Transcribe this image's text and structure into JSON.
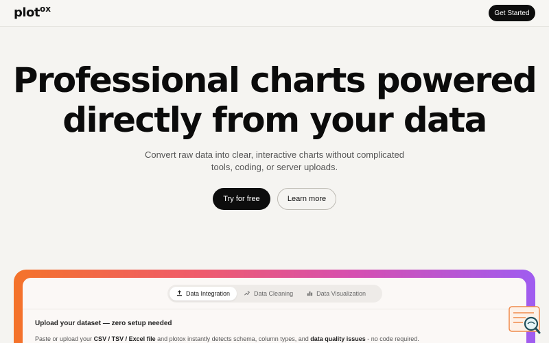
{
  "header": {
    "logo_text": "plot",
    "logo_sup": "ox",
    "cta_label": "Get Started"
  },
  "hero": {
    "title_line1": "Professional charts powered",
    "title_line2": "directly from your data",
    "subtitle_line1": "Convert raw data into clear, interactive charts without complicated",
    "subtitle_line2": "tools, coding, or server uploads.",
    "primary_cta": "Try for free",
    "secondary_cta": "Learn more"
  },
  "demo": {
    "tabs": [
      {
        "label": "Data Integration",
        "icon": "upload-icon",
        "active": true
      },
      {
        "label": "Data Cleaning",
        "icon": "sparkle-line-icon",
        "active": false
      },
      {
        "label": "Data Visualization",
        "icon": "bar-chart-icon",
        "active": false
      }
    ],
    "heading": "Upload your dataset — zero setup needed",
    "text_part1": "Paste or upload your ",
    "text_bold1": "CSV / TSV / Excel file",
    "text_part2": " and plotox instantly detects schema, column types, and ",
    "text_bold2": "data quality issues",
    "text_part3": " - no code required."
  },
  "colors": {
    "gradient_start": "#f4732a",
    "gradient_mid": "#d64fb0",
    "gradient_end": "#9f5cf0",
    "dark_button": "#0d0d0d"
  },
  "chat_widget": {
    "icon": "search-chat-icon"
  }
}
